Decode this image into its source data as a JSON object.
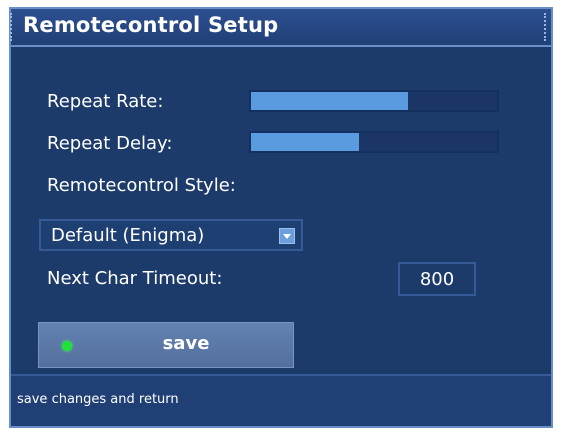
{
  "window": {
    "title": "Remotecontrol Setup"
  },
  "settings": {
    "repeat_rate": {
      "label": "Repeat Rate:",
      "value_fraction": 0.64
    },
    "repeat_delay": {
      "label": "Repeat Delay:",
      "value_fraction": 0.44
    },
    "style": {
      "label": "Remotecontrol Style:",
      "selected": "Default (Enigma)",
      "icon": "chevron-down-icon"
    },
    "next_char_timeout": {
      "label": "Next Char Timeout:",
      "value": "800"
    }
  },
  "actions": {
    "save_label": "save",
    "save_indicator_color": "#22e03a"
  },
  "status": {
    "text": "save changes and return"
  },
  "colors": {
    "background": "#1c3b6a",
    "accent": "#5a9be0",
    "border": "#6a8fc6"
  }
}
